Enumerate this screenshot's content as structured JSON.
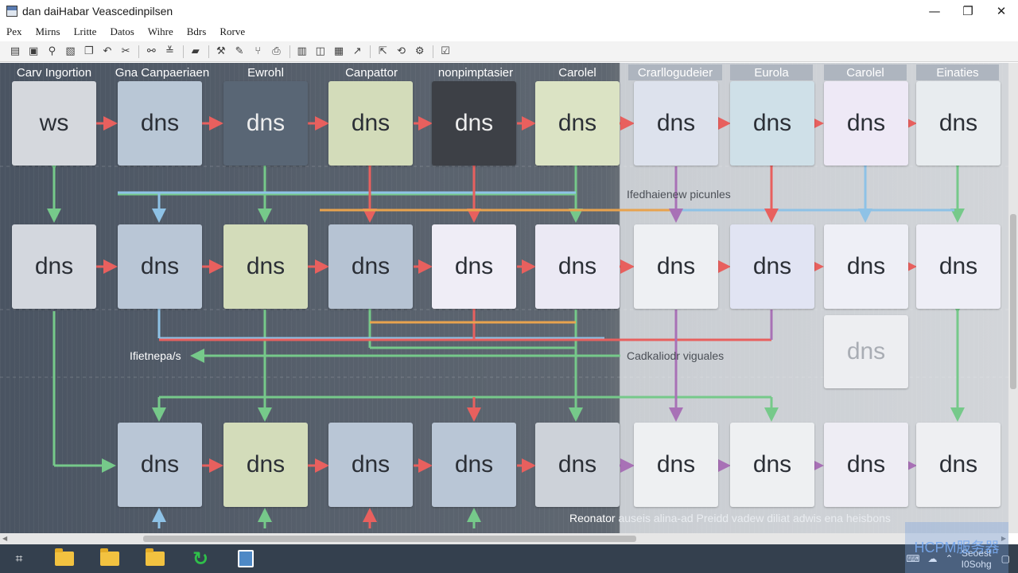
{
  "window": {
    "title": "dan daiHabar Veascedinpilsen",
    "controls": {
      "minimize": "—",
      "maximize": "❐",
      "close": "✕"
    }
  },
  "menu": [
    "Pex",
    "Mirns",
    "Lritte",
    "Datos",
    "Wihre",
    "Bdrs",
    "Rorve"
  ],
  "toolbar_icons": [
    "open-icon",
    "save-icon",
    "zoom-icon",
    "image-icon",
    "copy-icon",
    "undo-icon",
    "cut-icon",
    "link-icon",
    "align-icon",
    "stack-icon",
    "tool-icon",
    "edit-icon",
    "branch-icon",
    "print-icon",
    "chart-icon",
    "layers-icon",
    "form-icon",
    "trend-icon",
    "pointer-icon",
    "rotate-icon",
    "settings-icon",
    "check-icon"
  ],
  "lanes": [
    "Carv Ingortion",
    "Gna Canpaeriaen",
    "Ewrohl",
    "Canpattor",
    "nonpimptasier",
    "Carolel",
    "Crarllogudeier",
    "Eurola",
    "Carolel",
    "Einaties"
  ],
  "nodes": [
    "ws",
    "dns",
    "dns",
    "dns",
    "dns",
    "dns",
    "dns",
    "dns",
    "dns",
    "dns",
    "dns",
    "dns",
    "dns",
    "dns",
    "dns",
    "dns",
    "dns",
    "dns",
    "dns",
    "dns",
    "dns",
    "dns",
    "dns",
    "dns",
    "dns",
    "dns",
    "dns",
    "dns",
    "dns",
    "dns"
  ],
  "notes": {
    "top_right": "Ifedhaienew picunles",
    "middle_left": "Ifietnepa/s",
    "middle_right": "Cadkaliodr viguales",
    "footer_start": "Reonator",
    "footer_rest": "auseis alina-ad Preidd vadew diliat adwis ena heisbons"
  },
  "taskbar": {
    "clock_top": "Seoest",
    "clock_bottom": "I0Sohg",
    "watermark": "HCPM服务器"
  },
  "colors": {
    "canvas_dark": "#4a5462",
    "canvas_light": "#d2d5d9",
    "arrow_red": "#e8605e",
    "arrow_green": "#76c98a",
    "arrow_blue": "#8ec2e6",
    "arrow_orange": "#e8a34e",
    "arrow_purple": "#a871b6",
    "taskbar": "#34404e"
  }
}
